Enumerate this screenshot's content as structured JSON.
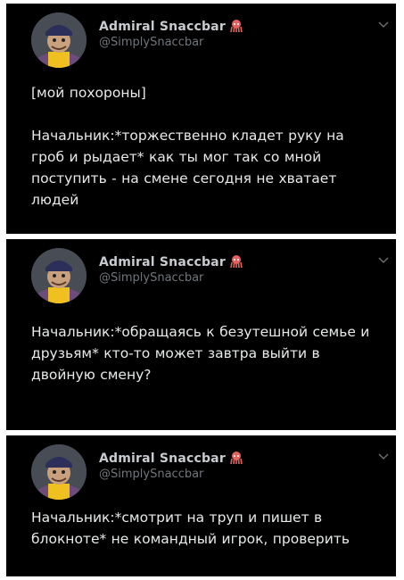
{
  "tweets": [
    {
      "author": {
        "display_name": "Admiral Snaccbar",
        "handle": "@SimplySnaccbar",
        "badge_icon": "octopus-icon"
      },
      "text": "[мой похороны]\n\nНачальник:*торжественно кладет руку на гроб и рыдает* как ты мог так со мной поступить - на смене сегодня не хватает людей"
    },
    {
      "author": {
        "display_name": "Admiral Snaccbar",
        "handle": "@SimplySnaccbar",
        "badge_icon": "octopus-icon"
      },
      "text": "Начальник:*обращаясь к безутешной семье и друзьям* кто-то может завтра выйти в двойную смену?"
    },
    {
      "author": {
        "display_name": "Admiral Snaccbar",
        "handle": "@SimplySnaccbar",
        "badge_icon": "octopus-icon"
      },
      "text": "Начальник:*смотрит на труп и пишет в блокноте* не командный игрок, проверить"
    }
  ],
  "colors": {
    "panel_background": "#000000",
    "page_background": "#ffffff",
    "text_primary": "#e7e9ea",
    "text_secondary": "#71767b",
    "badge": "#e0635f"
  }
}
